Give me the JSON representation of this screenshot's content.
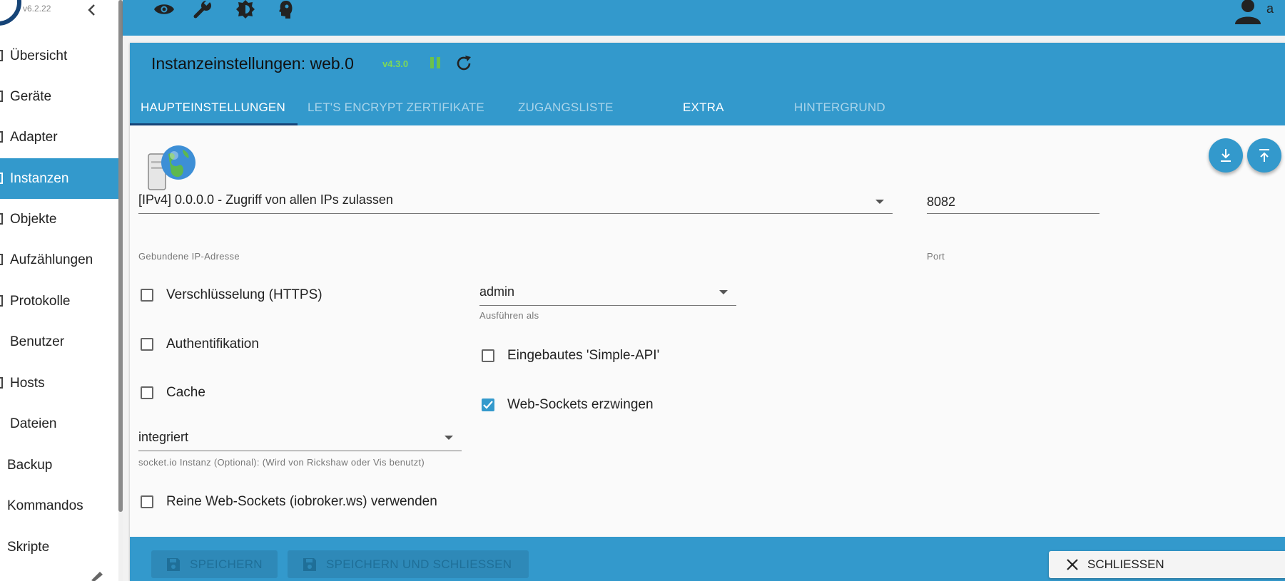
{
  "sidebar": {
    "version": "v6.2.22",
    "items": [
      {
        "label": "Übersicht"
      },
      {
        "label": "Geräte"
      },
      {
        "label": "Adapter"
      },
      {
        "label": "Instanzen"
      },
      {
        "label": "Objekte"
      },
      {
        "label": "Aufzählungen"
      },
      {
        "label": "Protokolle"
      },
      {
        "label": "Benutzer"
      },
      {
        "label": "Hosts"
      },
      {
        "label": "Dateien"
      },
      {
        "label": "Backup"
      },
      {
        "label": "Kommandos"
      },
      {
        "label": "Skripte"
      }
    ],
    "active": "Instanzen"
  },
  "appbar": {
    "tools": [
      "eye-icon",
      "wrench-icon",
      "brightness-icon",
      "expert-icon"
    ],
    "user_initial": "a"
  },
  "panel": {
    "title": "Instanzeinstellungen: web.0",
    "version": "v4.3.0",
    "tabs": [
      {
        "label": "HAUPTEINSTELLUNGEN"
      },
      {
        "label": "LET'S ENCRYPT ZERTIFIKATE"
      },
      {
        "label": "ZUGANGSLISTE"
      },
      {
        "label": "EXTRA"
      },
      {
        "label": "HINTERGRUND"
      }
    ]
  },
  "form": {
    "bind_ip": {
      "value": "[IPv4] 0.0.0.0 - Zugriff von allen IPs zulassen",
      "helper": "Gebundene IP-Adresse"
    },
    "port": {
      "value": "8082",
      "helper": "Port"
    },
    "https": {
      "label": "Verschlüsselung (HTTPS)",
      "checked": false
    },
    "auth": {
      "label": "Authentifikation",
      "checked": false
    },
    "cache": {
      "label": "Cache",
      "checked": false
    },
    "run_as": {
      "value": "admin",
      "helper": "Ausführen als"
    },
    "simple_api": {
      "label": "Eingebautes 'Simple-API'",
      "checked": false
    },
    "force_ws": {
      "label": "Web-Sockets erzwingen",
      "checked": true
    },
    "socketio": {
      "value": "integriert",
      "helper": "socket.io Instanz (Optional): (Wird von Rickshaw oder Vis benutzt)"
    },
    "pure_ws": {
      "label": "Reine Web-Sockets (iobroker.ws) verwenden",
      "checked": false
    }
  },
  "footer": {
    "save": "SPEICHERN",
    "save_close": "SPEICHERN UND SCHLIESSEN",
    "close": "SCHLIESSEN"
  },
  "colors": {
    "primary": "#3399cc",
    "indicator": "#164477",
    "version_green": "#7ed957"
  }
}
